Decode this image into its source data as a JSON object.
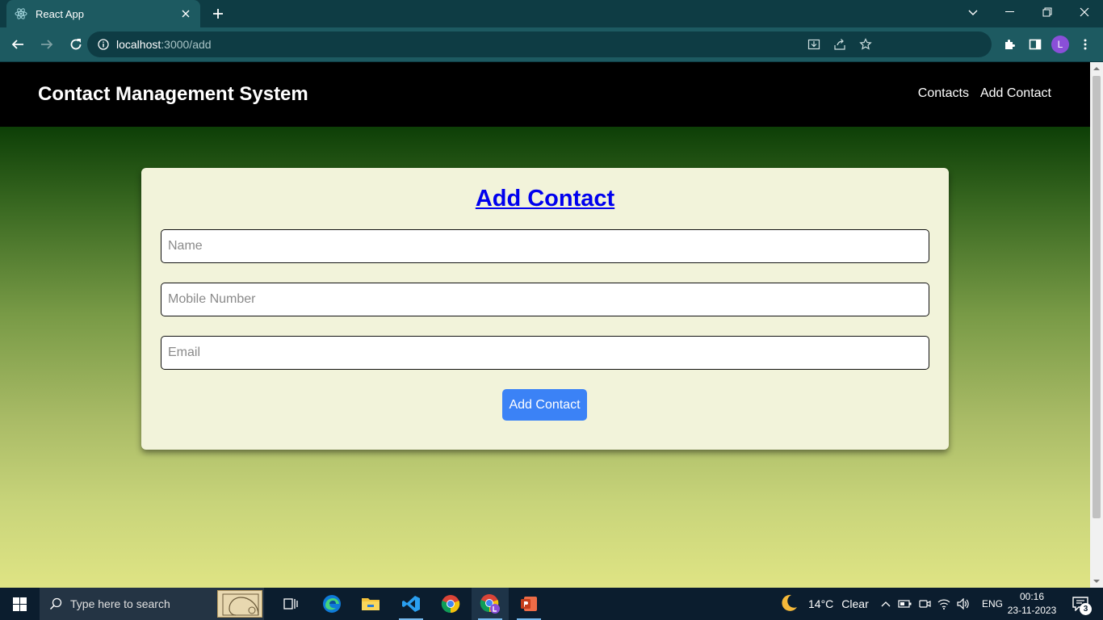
{
  "browser": {
    "tab_title": "React App",
    "url_host": "localhost",
    "url_path": ":3000/add",
    "profile_initial": "L"
  },
  "app": {
    "brand": "Contact Management System",
    "nav_links": [
      "Contacts",
      "Add Contact"
    ]
  },
  "form": {
    "title": "Add Contact",
    "name_placeholder": "Name",
    "mobile_placeholder": "Mobile Number",
    "email_placeholder": "Email",
    "submit_label": "Add Contact"
  },
  "taskbar": {
    "search_placeholder": "Type here to search",
    "weather_temp": "14°C",
    "weather_desc": "Clear",
    "language": "ENG",
    "time": "00:16",
    "date": "23-11-2023",
    "notification_count": "3"
  },
  "colors": {
    "chrome_dark": "#0e3c44",
    "chrome_light": "#1d5a61",
    "nav_bg": "#000000",
    "card_bg": "#f2f3da",
    "title_link": "#0000ee",
    "button_bg": "#3b82f6",
    "gradient_top": "#0a3a05",
    "gradient_bottom": "#dfe484"
  },
  "icons": [
    "react-favicon-icon",
    "close-icon",
    "plus-icon",
    "chevron-down-icon",
    "minimize-icon",
    "restore-icon",
    "back-arrow-icon",
    "forward-arrow-icon",
    "reload-icon",
    "info-icon",
    "install-icon",
    "share-icon",
    "star-icon",
    "extensions-icon",
    "sidepanel-icon",
    "kebab-menu-icon",
    "windows-start-icon",
    "search-icon",
    "task-view-icon",
    "edge-icon",
    "file-explorer-icon",
    "vscode-icon",
    "chrome-icon",
    "chrome-profile-icon",
    "powerpoint-icon",
    "moon-icon",
    "chevron-up-icon",
    "battery-icon",
    "meet-now-icon",
    "wifi-icon",
    "speaker-icon",
    "notification-icon"
  ]
}
